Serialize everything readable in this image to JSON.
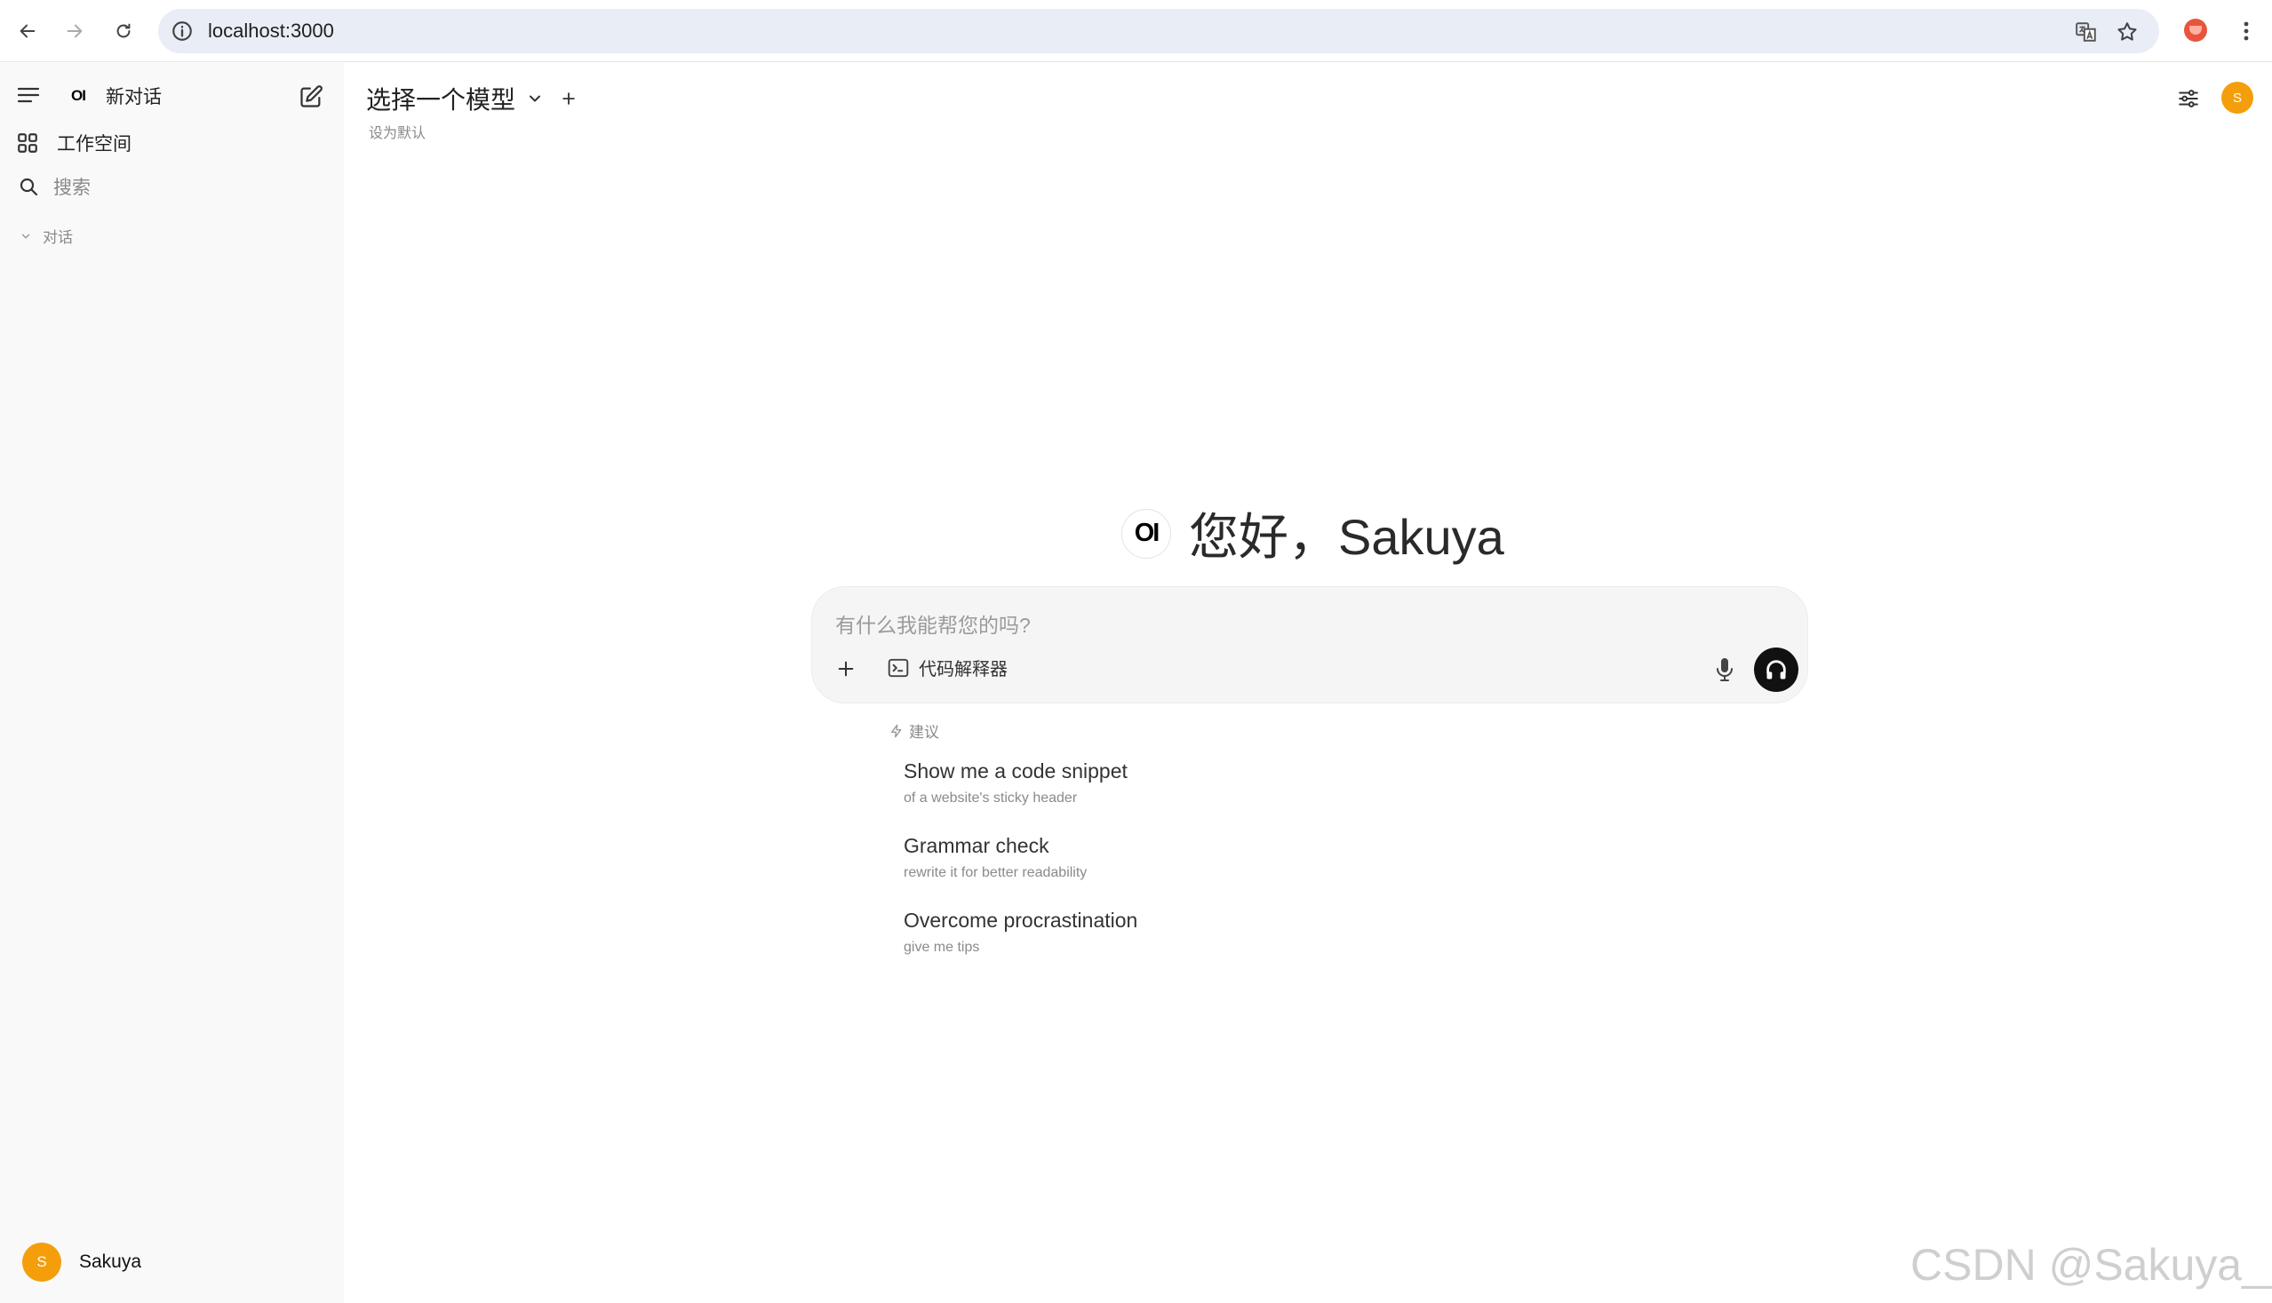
{
  "browser": {
    "url": "localhost:3000"
  },
  "sidebar": {
    "new_chat": "新对话",
    "logo_text": "OI",
    "workspace": "工作空间",
    "search": "搜索",
    "section_chats": "对话",
    "user": {
      "initial": "S",
      "name": "Sakuya"
    }
  },
  "header": {
    "model_select": "选择一个模型",
    "set_default": "设为默认",
    "avatar_initial": "S"
  },
  "greeting": {
    "logo_text": "OI",
    "text": "您好，Sakuya"
  },
  "chat_input": {
    "placeholder": "有什么我能帮您的吗?",
    "code_interpreter": "代码解释器"
  },
  "suggestions": {
    "header": "建议",
    "items": [
      {
        "title": "Show me a code snippet",
        "subtitle": "of a website's sticky header"
      },
      {
        "title": "Grammar check",
        "subtitle": "rewrite it for better readability"
      },
      {
        "title": "Overcome procrastination",
        "subtitle": "give me tips"
      }
    ]
  },
  "watermark": "CSDN @Sakuya__",
  "colors": {
    "avatar": "#f59e0b",
    "sidebar_bg": "#f9f9f9",
    "omnibox_bg": "#e9eef6"
  }
}
